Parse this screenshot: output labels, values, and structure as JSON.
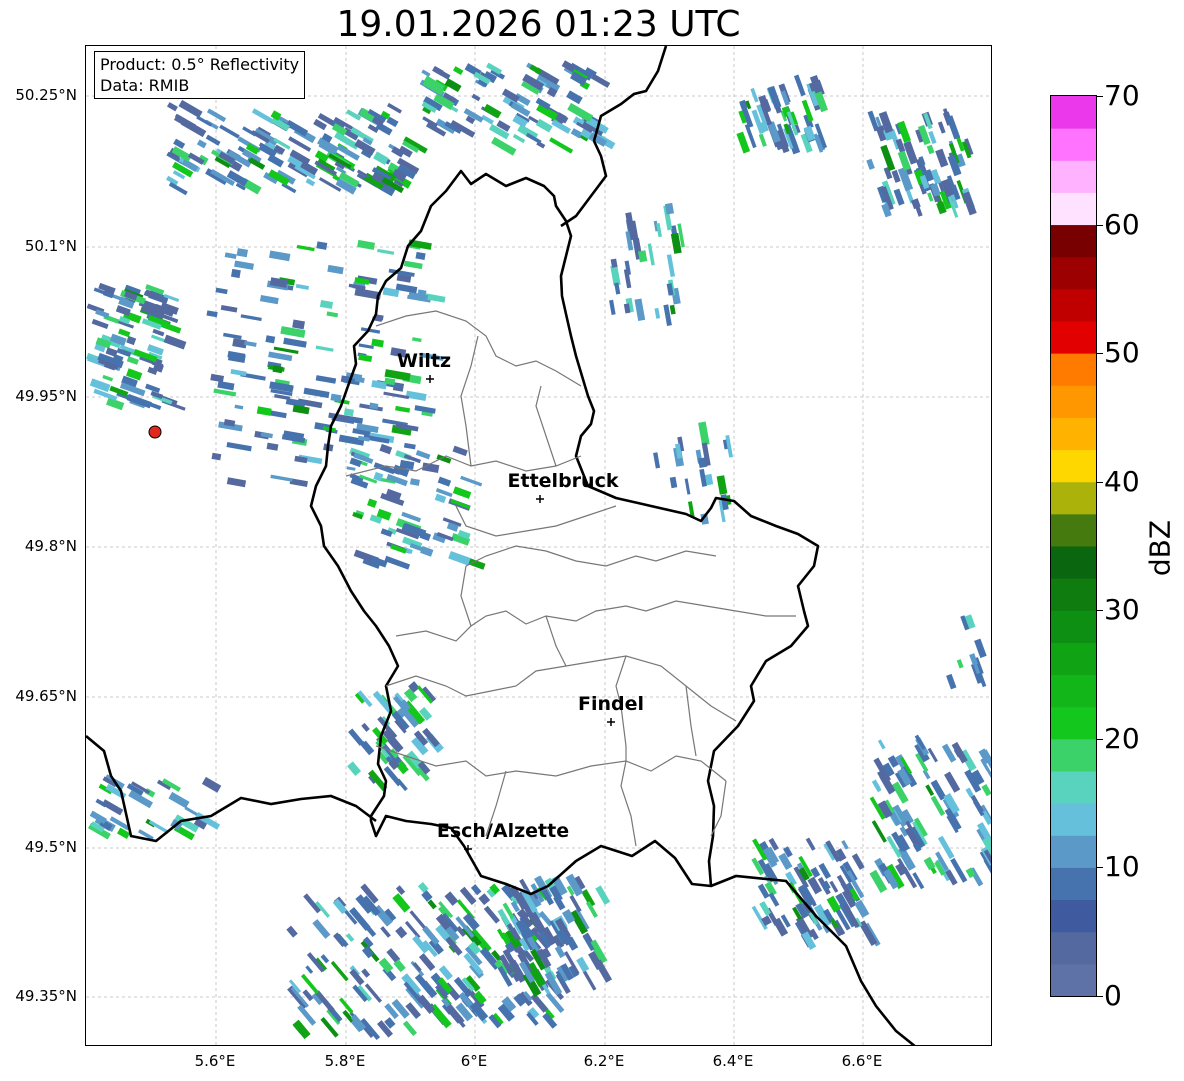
{
  "title": "19.01.2026 01:23 UTC",
  "info": {
    "product": "Product: 0.5° Reflectivity",
    "data": "Data: RMIB"
  },
  "axes": {
    "lat_labels": [
      "50.25°N",
      "50.1°N",
      "49.95°N",
      "49.8°N",
      "49.65°N",
      "49.5°N",
      "49.35°N"
    ],
    "lon_labels": [
      "5.6°E",
      "5.8°E",
      "6°E",
      "6.2°E",
      "6.4°E",
      "6.6°E"
    ]
  },
  "cities": [
    {
      "name": "Wiltz"
    },
    {
      "name": "Ettelbruck"
    },
    {
      "name": "Findel"
    },
    {
      "name": "Esch/Alzette"
    }
  ],
  "colorbar": {
    "label": "dBZ",
    "ticks": [
      "0",
      "10",
      "20",
      "30",
      "40",
      "50",
      "60",
      "70"
    ],
    "colors": [
      "#5f72a8",
      "#53699f",
      "#405aa0",
      "#4673ad",
      "#5a99c8",
      "#65c1db",
      "#59d3be",
      "#3bd26a",
      "#14c71d",
      "#12b618",
      "#10a414",
      "#0c8f12",
      "#0e7c0f",
      "#0b6610",
      "#447a0e",
      "#abb30a",
      "#ffd700",
      "#ffb300",
      "#ff9800",
      "#ff7b00",
      "#e30000",
      "#c00000",
      "#9c0000",
      "#780000",
      "#ffe2ff",
      "#ffb2ff",
      "#ff73ff",
      "#ea38ea"
    ]
  }
}
